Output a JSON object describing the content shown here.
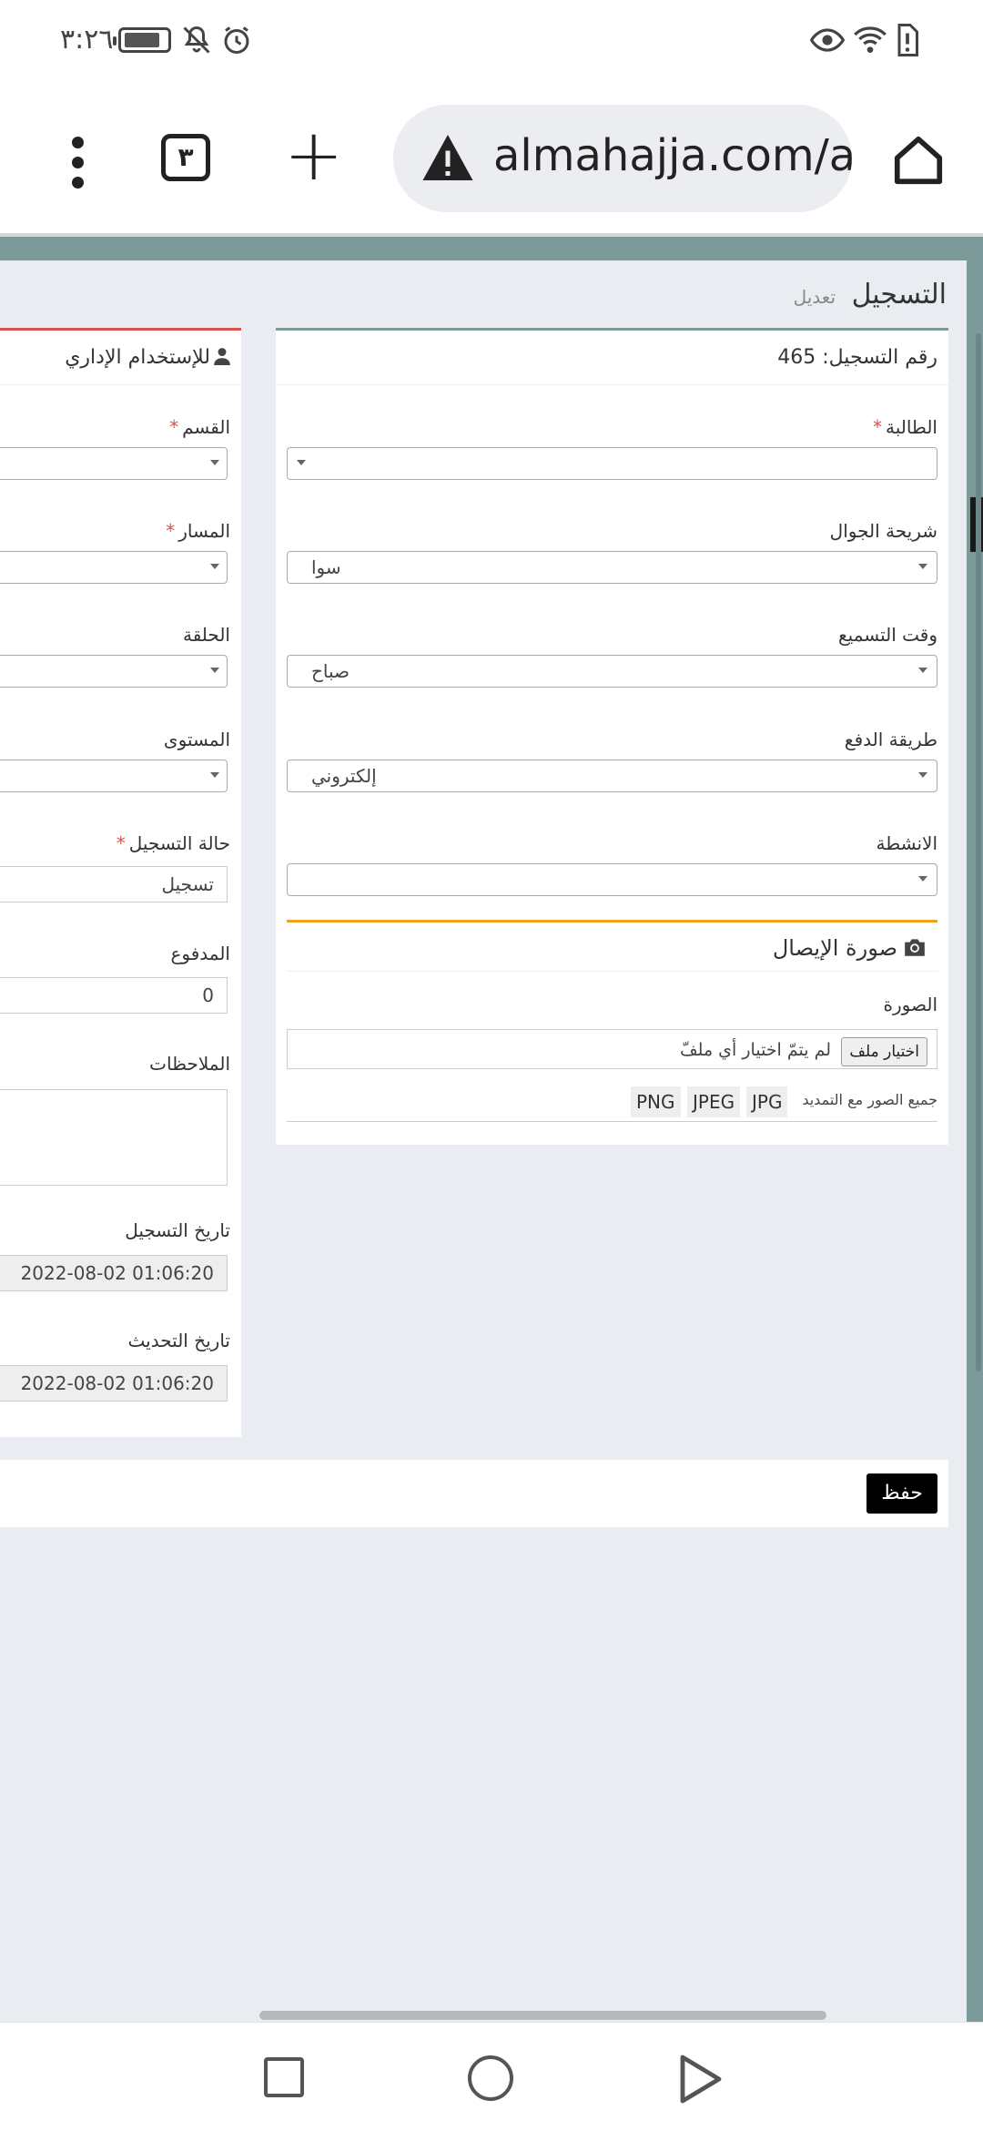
{
  "status_bar": {
    "time": "٣:٢٦",
    "icons": [
      "battery-icon",
      "mute-icon",
      "alarm-icon",
      "eye-icon",
      "wifi-icon",
      "alert-icon"
    ]
  },
  "browser": {
    "url": "almahajja.com/ac",
    "tab_count": "٣",
    "icons": [
      "more-vert-icon",
      "tabs-icon",
      "new-tab-icon",
      "warning-icon",
      "home-icon"
    ]
  },
  "page_header": {
    "title": "التسجيل",
    "subtitle": "تعديل"
  },
  "registration_card": {
    "number_label": "رقم التسجيل: 465",
    "fields": [
      {
        "label": "الطالبة",
        "required": true,
        "value": ""
      },
      {
        "label": "شريحة الجوال",
        "required": false,
        "value": "سوا"
      },
      {
        "label": "وقت التسميع",
        "required": false,
        "value": "صباح"
      },
      {
        "label": "طريقة الدفع",
        "required": false,
        "value": "إلكتروني"
      },
      {
        "label": "الانشطة",
        "required": false,
        "value": ""
      }
    ],
    "receipt": {
      "title": "صورة الإيصال",
      "image_label": "الصورة",
      "file_button": "اختيار ملف",
      "file_status": "لم يتمّ اختيار أي ملفّ",
      "note": "جميع الصور مع التمديد",
      "extensions": [
        "JPG",
        "JPEG",
        "PNG"
      ]
    }
  },
  "admin_card": {
    "title": "للإستخدام الإداري",
    "fields": {
      "section": {
        "label": "القسم",
        "required": true,
        "value": ""
      },
      "track": {
        "label": "المسار",
        "required": true,
        "value": ""
      },
      "circle": {
        "label": "الحلقة",
        "required": false,
        "value": ""
      },
      "level": {
        "label": "المستوى",
        "required": false,
        "value": ""
      },
      "status": {
        "label": "حالة التسجيل",
        "required": true,
        "value": "تسجيل"
      },
      "paid": {
        "label": "المدفوع",
        "required": false,
        "value": "0"
      },
      "notes": {
        "label": "الملاحظات",
        "required": false,
        "value": ""
      },
      "registered_at": {
        "label": "تاريخ التسجيل",
        "value": "2022-08-02 01:06:20"
      },
      "updated_at": {
        "label": "تاريخ التحديث",
        "value": "2022-08-02 01:06:20"
      }
    }
  },
  "actions": {
    "save": "حفظ"
  },
  "colors": {
    "accent_teal": "#7d9a9a",
    "admin_accent": "#d9534f",
    "receipt_accent": "#f0a020",
    "page_bg": "#e9edf2"
  }
}
